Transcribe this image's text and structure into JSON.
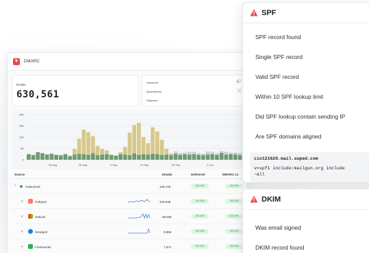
{
  "dashboard": {
    "title": "DMARC",
    "emails_label": "Emails",
    "emails_count": "630,561",
    "status": {
      "delivered_label": "Delivered",
      "quarantined_label": "Quarantined",
      "rejected_label": "Rejected",
      "delivered_value": "47",
      "quarantined_value": "1("
    },
    "chart": {
      "y_ticks": [
        "24K",
        "18K",
        "12K",
        "6K",
        "0"
      ],
      "x_ticks": [
        "16 Aug",
        "26 Aug",
        "4 Sep",
        "13 Sep",
        "23 Sep",
        "2 Oct"
      ]
    },
    "table": {
      "headers": [
        "Source",
        "Emails",
        "Delivered",
        "DMARC co"
      ],
      "rows": [
        {
          "name": "Authorized",
          "emails": "436,725",
          "delivered": "100.00%",
          "dmarc": "100.00%"
        },
        {
          "name": "Hubspot",
          "emails": "329,635",
          "delivered": "100.00%",
          "dmarc": "100.00%"
        },
        {
          "name": "Outlook",
          "emails": "68,936",
          "delivered": "100.00%",
          "dmarc": "100.00%"
        },
        {
          "name": "Sendgrid",
          "emails": "9,866",
          "delivered": "100.00%",
          "dmarc": "100.00%"
        },
        {
          "name": "Freshworks",
          "emails": "7,674",
          "delivered": "100.00%",
          "dmarc": "100.00%"
        }
      ]
    }
  },
  "chart_data": {
    "type": "bar",
    "title": "",
    "xlabel": "",
    "ylabel": "",
    "ylim": [
      0,
      24000
    ],
    "x_tick_labels": [
      "16 Aug",
      "26 Aug",
      "4 Sep",
      "13 Sep",
      "23 Sep",
      "2 Oct"
    ],
    "y_tick_labels": [
      "24K",
      "18K",
      "12K",
      "6K",
      "0"
    ],
    "series": [
      {
        "color": "#6f9a73",
        "values": [
          3000,
          2500,
          4000,
          3500,
          2800,
          3200,
          2600,
          2400,
          3000,
          2000,
          2800,
          3200,
          3000,
          2600,
          3500,
          2400,
          2800,
          3000,
          2600,
          2200,
          3000,
          2800,
          2400,
          3400,
          2600,
          3000,
          2800,
          3200,
          3000,
          2600,
          2800,
          2400,
          3200,
          2600,
          3000,
          2800,
          3000,
          2600,
          2400,
          2800,
          3000,
          2600,
          3600,
          2800,
          3000,
          2800,
          2400,
          3000
        ]
      },
      {
        "color": "#d6c98a",
        "values": [
          0,
          0,
          0,
          0,
          0,
          0,
          0,
          0,
          0,
          0,
          3000,
          8000,
          13000,
          12000,
          9000,
          5000,
          3000,
          2000,
          0,
          0,
          1000,
          4000,
          12000,
          15000,
          17000,
          9000,
          6000,
          14000,
          12000,
          8000,
          3000,
          1000,
          0,
          0,
          0,
          0,
          0,
          0,
          0,
          0,
          0,
          0,
          0,
          0,
          0,
          0,
          0,
          0
        ]
      },
      {
        "color": "#c8d0d8",
        "values": [
          0,
          0,
          0,
          0,
          0,
          0,
          0,
          0,
          0,
          0,
          0,
          0,
          0,
          0,
          0,
          0,
          0,
          0,
          0,
          0,
          0,
          0,
          0,
          0,
          0,
          0,
          0,
          0,
          0,
          0,
          0,
          0,
          1200,
          1000,
          800,
          1400,
          1200,
          1000,
          800,
          1600,
          1200,
          900,
          1000,
          1400,
          800,
          1000,
          1200,
          900
        ]
      }
    ]
  },
  "spf": {
    "title": "SPF",
    "items": [
      "SPF record found",
      "Single SPF record",
      "Valid SPF record",
      "Within 10 SPF lookup limit",
      "Did SPF lookup contain sending IP",
      "Are SPF domains aligned"
    ],
    "code_domain": "cio121626.mail.suped.com",
    "code_record_line1": "v=spf1 include:mailgun.org include",
    "code_record_line2": "~all"
  },
  "dkim": {
    "title": "DKIM",
    "items": [
      "Was email signed",
      "DKIM record found"
    ]
  },
  "colors": {
    "warning": "#e5484d",
    "delivered_green": "#3aa55d",
    "quarantine_gold": "#d99a1c",
    "bar_green": "#6f9a73",
    "bar_gold": "#d6c98a"
  }
}
